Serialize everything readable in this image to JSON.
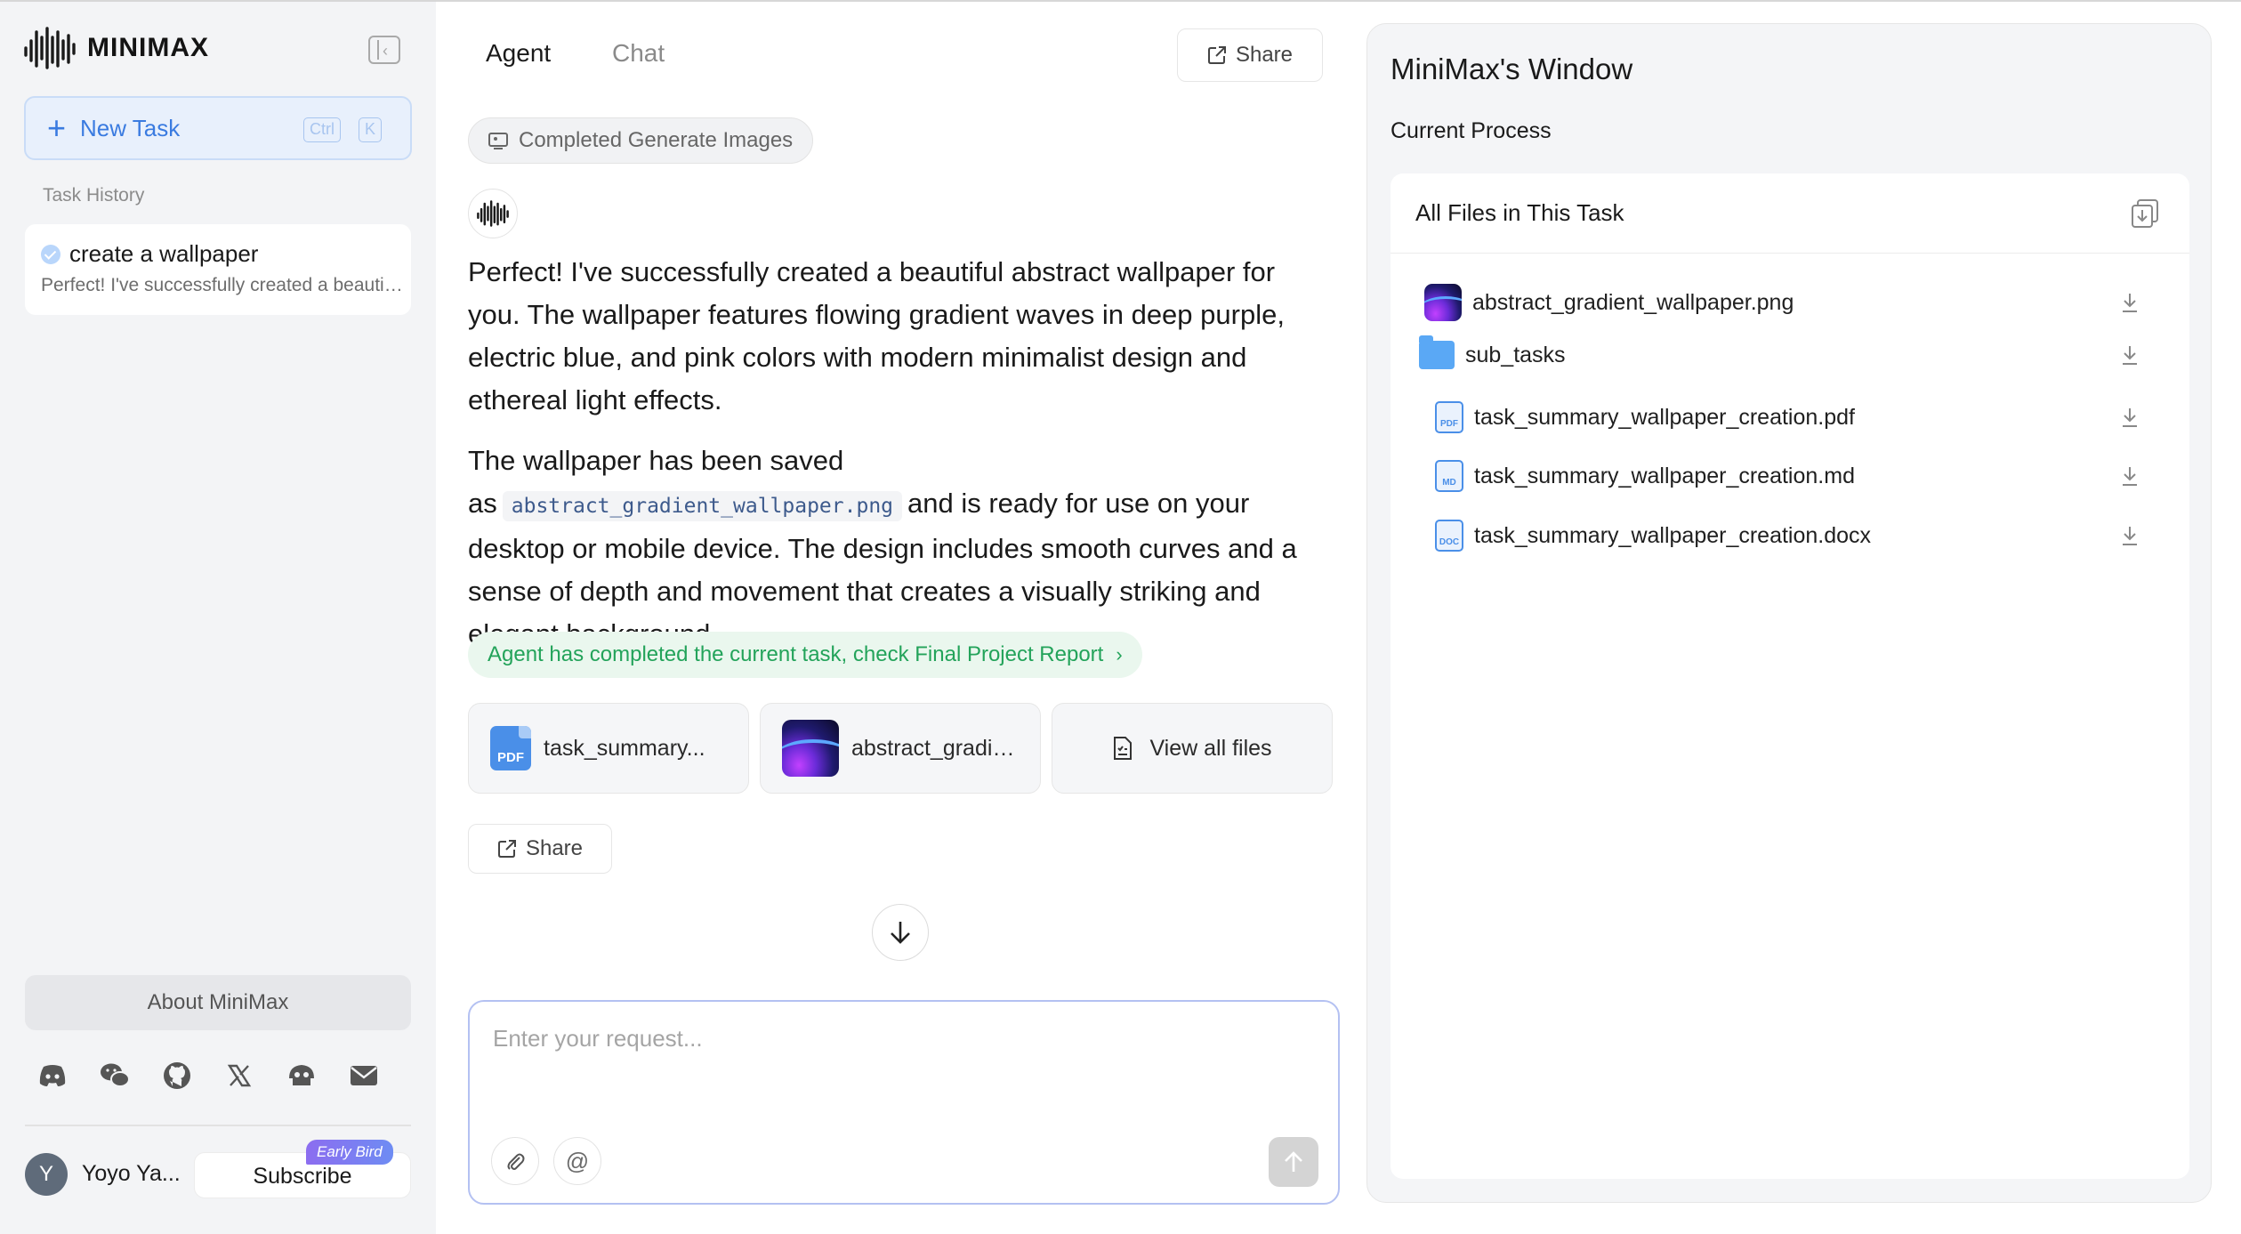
{
  "sidebar": {
    "logo_text": "MINIMAX",
    "new_task_label": "New Task",
    "shortcut_ctrl": "Ctrl",
    "shortcut_key": "K",
    "task_history_label": "Task History",
    "tasks": [
      {
        "title": "create a wallpaper",
        "preview": "Perfect! I've successfully created a beautiful abstract wallpaper for you."
      }
    ],
    "about_label": "About MiniMax",
    "socials": [
      "discord-icon",
      "wechat-icon",
      "github-icon",
      "x-icon",
      "community-icon",
      "mail-icon"
    ],
    "user": {
      "initial": "Y",
      "name": "Yoyo Ya..."
    },
    "subscribe_label": "Subscribe",
    "early_bird_label": "Early Bird"
  },
  "main": {
    "tabs": [
      {
        "label": "Agent",
        "active": true
      },
      {
        "label": "Chat",
        "active": false
      }
    ],
    "share_label": "Share",
    "status_chip": "Completed Generate Images",
    "message": {
      "para1": "Perfect! I've successfully created a beautiful abstract wallpaper for you. The wallpaper features flowing gradient waves in deep purple, electric blue, and pink colors with modern minimalist design and ethereal light effects.",
      "para2_prefix": "The wallpaper has been saved as",
      "para2_code": "abstract_gradient_wallpaper.png",
      "para2_suffix": "and is ready for use on your desktop or mobile device. The design includes smooth curves and a sense of depth and movement that creates a visually striking and elegant background."
    },
    "report_link": "Agent has completed the current task, check Final Project Report",
    "file_cards": [
      {
        "name": "task_summary...",
        "icon": "pdf-icon"
      },
      {
        "name": "abstract_gradie...",
        "icon": "image-thumbnail"
      },
      {
        "name": "View all files",
        "icon": "file-list-icon"
      }
    ],
    "share_bottom_label": "Share",
    "input_placeholder": "Enter your request...",
    "input_value": ""
  },
  "right_panel": {
    "title": "MiniMax's Window",
    "subtitle": "Current Process",
    "files_header": "All Files in This Task",
    "files": [
      {
        "name": "abstract_gradient_wallpaper.png",
        "type": "image"
      },
      {
        "name": "sub_tasks",
        "type": "folder"
      },
      {
        "name": "task_summary_wallpaper_creation.pdf",
        "type": "pdf",
        "badge": "PDF"
      },
      {
        "name": "task_summary_wallpaper_creation.md",
        "type": "md",
        "badge": "MD"
      },
      {
        "name": "task_summary_wallpaper_creation.docx",
        "type": "docx",
        "badge": "DOC"
      }
    ]
  },
  "colors": {
    "accent_blue": "#3a7be0",
    "success_green": "#23a35a",
    "sidebar_bg": "#f3f4f6"
  }
}
